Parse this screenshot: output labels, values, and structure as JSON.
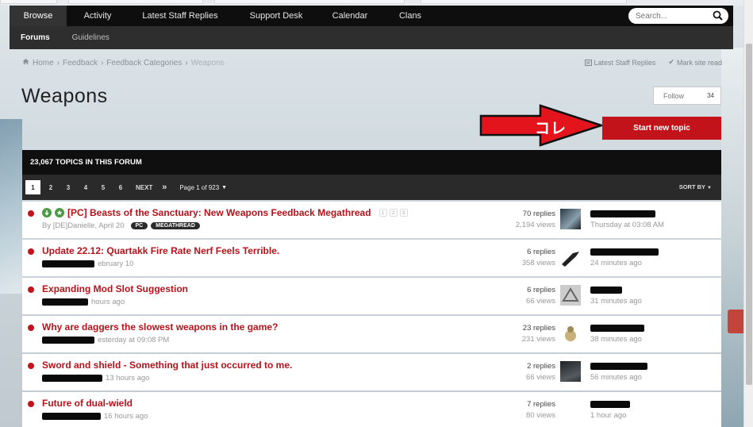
{
  "nav": {
    "tabs": [
      "Browse",
      "Activity",
      "Latest Staff Replies",
      "Support Desk",
      "Calendar",
      "Clans"
    ],
    "search_placeholder": "Search..."
  },
  "subnav": [
    "Forums",
    "Guidelines"
  ],
  "breadcrumb": [
    "Home",
    "Feedback",
    "Feedback Categories",
    "Weapons"
  ],
  "breadcrumb_actions": {
    "staff": "Latest Staff Replies",
    "mark": "Mark site read"
  },
  "page": {
    "title": "Weapons",
    "follow": "Follow",
    "follow_count": "34",
    "start_topic": "Start new topic"
  },
  "annotation": {
    "text": "コレ",
    "color": "#e4141c"
  },
  "forum": {
    "topics_count": "23,067 TOPICS IN THIS FORUM",
    "pages": [
      "1",
      "2",
      "3",
      "4",
      "5",
      "6"
    ],
    "next": "NEXT",
    "last": "»",
    "page_of": "Page 1 of 923",
    "sort": "SORT BY"
  },
  "topics": [
    {
      "title": "[PC] Beasts of the Sanctuary: New Weapons Feedback Megathread",
      "author": "By [DE]Danielle, April 20",
      "replies": "70 replies",
      "views": "2,194 views",
      "last_when": "Thursday at 03:08 AM",
      "mini_pages": [
        "1",
        "2",
        "3"
      ],
      "tags": [
        "PC",
        "MEGATHREAD"
      ]
    },
    {
      "title": "Update 22.12: Quartakk Fire Rate Nerf Feels Terrible.",
      "author": "ebruary 10",
      "replies": "6 replies",
      "views": "358 views",
      "last_when": "24 minutes ago"
    },
    {
      "title": "Expanding Mod Slot Suggestion",
      "author": "hours ago",
      "replies": "6 replies",
      "views": "66 views",
      "last_when": "31 minutes ago"
    },
    {
      "title": "Why are daggers the slowest weapons in the game?",
      "author": "esterday at 09:08 PM",
      "replies": "23 replies",
      "views": "231 views",
      "last_when": "38 minutes ago"
    },
    {
      "title": "Sword and shield - Something that just occurred to me.",
      "author": "13 hours ago",
      "replies": "2 replies",
      "views": "66 views",
      "last_when": "56 minutes ago"
    },
    {
      "title": "Future of dual-wield",
      "author": "16 hours ago",
      "replies": "7 replies",
      "views": "80 views",
      "last_when": "1 hour ago"
    }
  ],
  "colors": {
    "accent": "#c3131a",
    "nav": "#0e0e0e"
  },
  "icons": [
    "home-icon",
    "search-icon",
    "check-icon",
    "sort-caret-icon"
  ]
}
